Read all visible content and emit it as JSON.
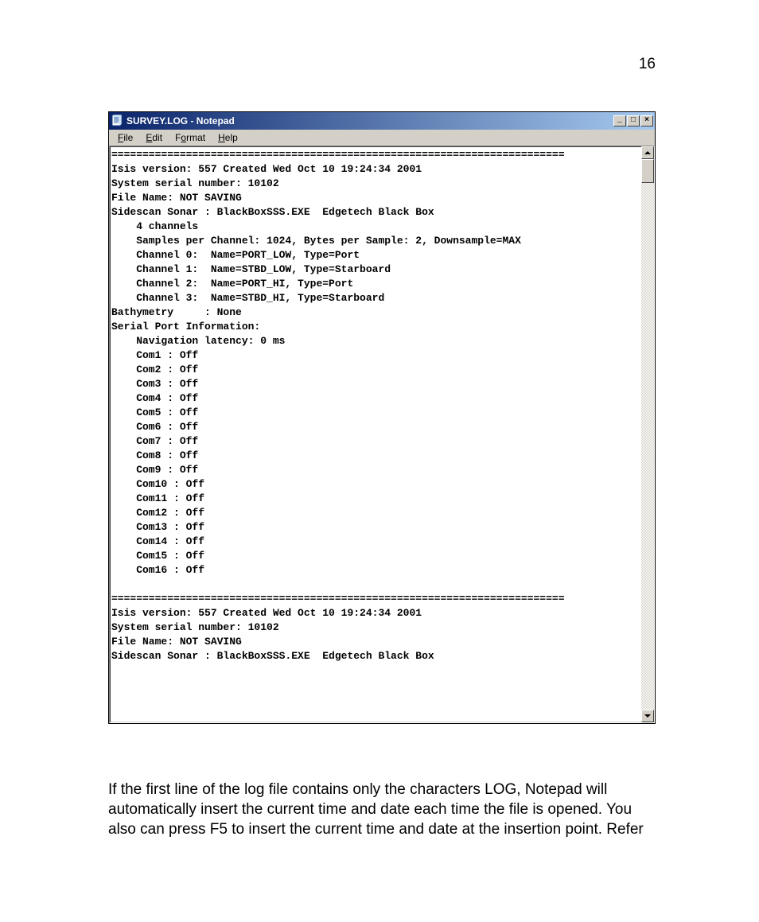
{
  "page_number": "16",
  "titlebar": {
    "title": "SURVEY.LOG - Notepad"
  },
  "window_controls": {
    "minimize": "_",
    "maximize": "□",
    "close": "×"
  },
  "menu": {
    "file": "File",
    "edit": "Edit",
    "format": "Format",
    "help": "Help"
  },
  "content_lines": [
    "=========================================================================",
    "Isis version: 557 Created Wed Oct 10 19:24:34 2001",
    "System serial number: 10102",
    "File Name: NOT SAVING",
    "Sidescan Sonar : BlackBoxSSS.EXE  Edgetech Black Box",
    "    4 channels",
    "    Samples per Channel: 1024, Bytes per Sample: 2, Downsample=MAX",
    "    Channel 0:  Name=PORT_LOW, Type=Port",
    "    Channel 1:  Name=STBD_LOW, Type=Starboard",
    "    Channel 2:  Name=PORT_HI, Type=Port",
    "    Channel 3:  Name=STBD_HI, Type=Starboard",
    "Bathymetry     : None",
    "Serial Port Information:",
    "    Navigation latency: 0 ms",
    "    Com1 : Off",
    "    Com2 : Off",
    "    Com3 : Off",
    "    Com4 : Off",
    "    Com5 : Off",
    "    Com6 : Off",
    "    Com7 : Off",
    "    Com8 : Off",
    "    Com9 : Off",
    "    Com10 : Off",
    "    Com11 : Off",
    "    Com12 : Off",
    "    Com13 : Off",
    "    Com14 : Off",
    "    Com15 : Off",
    "    Com16 : Off",
    "",
    "=========================================================================",
    "Isis version: 557 Created Wed Oct 10 19:24:34 2001",
    "System serial number: 10102",
    "File Name: NOT SAVING",
    "Sidescan Sonar : BlackBoxSSS.EXE  Edgetech Black Box"
  ],
  "caption": "If the first line of the log file contains only the characters LOG, Notepad will automatically insert the current time and date each time the file is opened. You also can press F5 to insert the current time and date at the insertion point. Refer"
}
